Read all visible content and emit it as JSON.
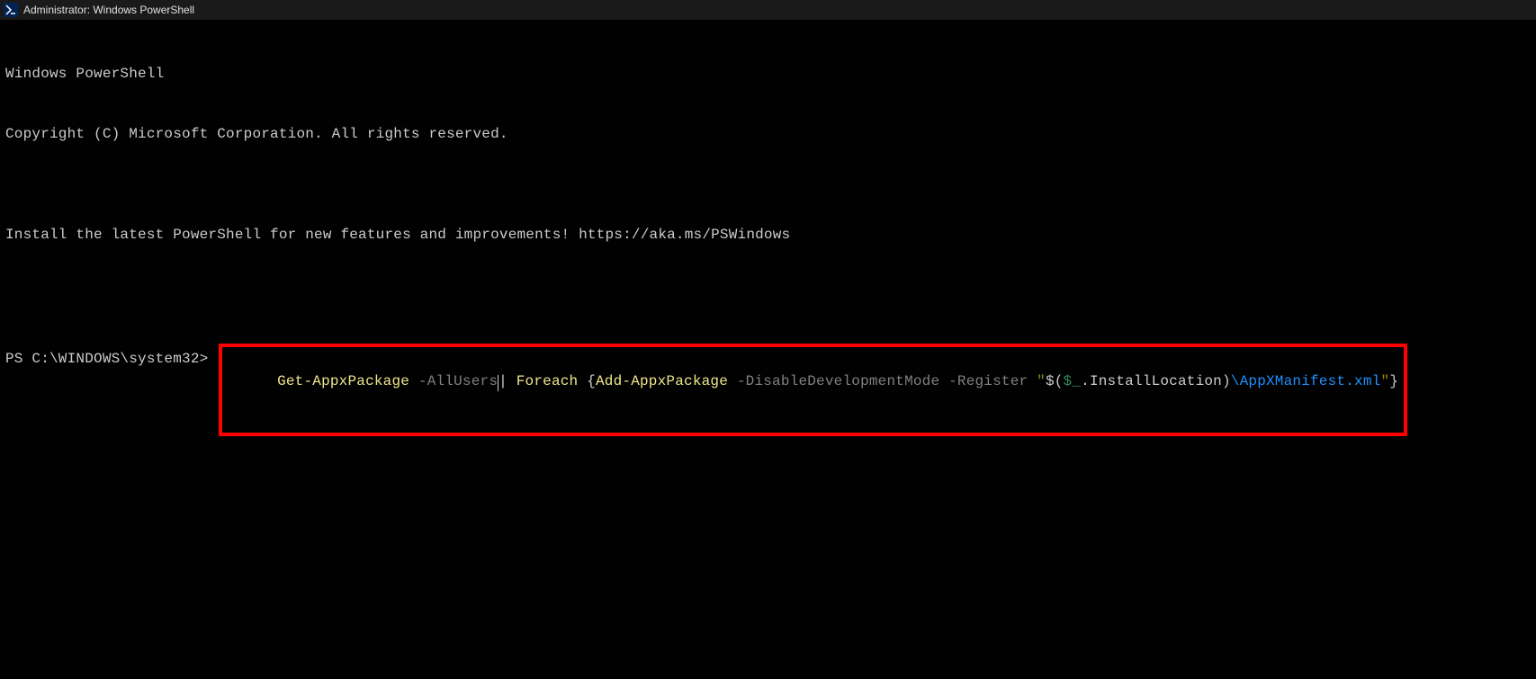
{
  "title": "Administrator: Windows PowerShell",
  "header": {
    "line1": "Windows PowerShell",
    "line2": "Copyright (C) Microsoft Corporation. All rights reserved.",
    "blank1": "",
    "line3": "Install the latest PowerShell for new features and improvements! https://aka.ms/PSWindows",
    "blank2": ""
  },
  "prompt": "PS C:\\WINDOWS\\system32> ",
  "command": {
    "seg1_cmdlet": "Get-AppxPackage",
    "seg2_space": " ",
    "seg3_param": "-AllUsers",
    "seg4_pipe": "|",
    "seg5_space": " ",
    "seg6_foreach": "Foreach",
    "seg7_space": " ",
    "seg8_brace_open": "{",
    "seg9_cmdlet": "Add-AppxPackage",
    "seg10_space": " ",
    "seg11_param": "-DisableDevelopmentMode",
    "seg12_space": " ",
    "seg13_param": "-Register",
    "seg14_space": " ",
    "seg15_quote": "\"",
    "seg16_subexpr_open": "$(",
    "seg17_pipevar": "$_",
    "seg18_member": ".InstallLocation",
    "seg19_subexpr_close": ")",
    "seg20_path": "\\AppXManifest.xml",
    "seg21_quote": "\"",
    "seg22_brace_close": "}"
  }
}
